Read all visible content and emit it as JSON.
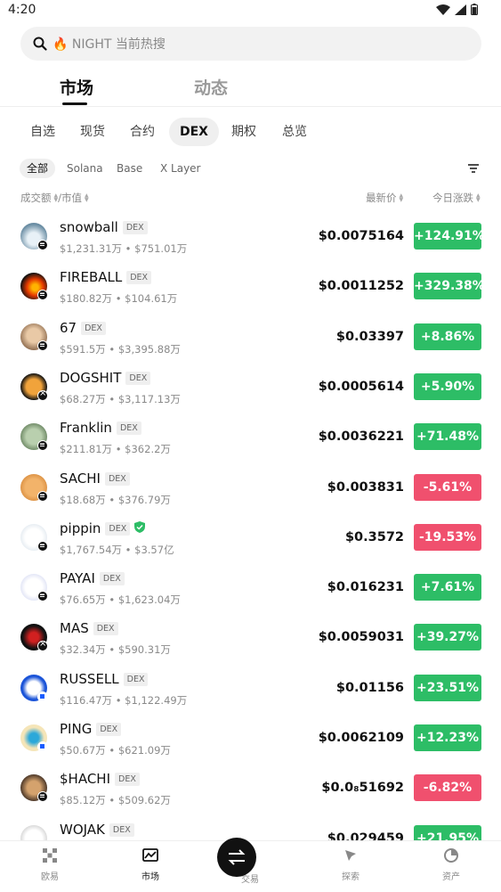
{
  "status": {
    "time": "4:20"
  },
  "search": {
    "placeholder": "🔥 NIGHT 当前热搜"
  },
  "main_tabs": [
    {
      "label": "市场"
    },
    {
      "label": "动态"
    }
  ],
  "category_tabs": [
    {
      "label": "自选"
    },
    {
      "label": "现货"
    },
    {
      "label": "合约"
    },
    {
      "label": "DEX"
    },
    {
      "label": "期权"
    },
    {
      "label": "总览"
    }
  ],
  "chain_tabs": [
    {
      "label": "全部"
    },
    {
      "label": "Solana"
    },
    {
      "label": "Base"
    },
    {
      "label": "X Layer"
    }
  ],
  "columns": {
    "volume": "成交额",
    "sep": " / ",
    "mcap": "市值",
    "price": "最新价",
    "change": "今日涨跌"
  },
  "badge": "DEX",
  "tokens": [
    {
      "name": "snowball",
      "vol": "$1,231.31万",
      "mcap": "$751.01万",
      "price": "$0.0075164",
      "change": "+124.91%",
      "dir": "up",
      "chain": "sol"
    },
    {
      "name": "FIREBALL",
      "vol": "$180.82万",
      "mcap": "$104.61万",
      "price": "$0.0011252",
      "change": "+329.38%",
      "dir": "up",
      "chain": "sol"
    },
    {
      "name": "67",
      "vol": "$591.5万",
      "mcap": "$3,395.88万",
      "price": "$0.03397",
      "change": "+8.86%",
      "dir": "up",
      "chain": "sol"
    },
    {
      "name": "DOGSHIT",
      "vol": "$68.27万",
      "mcap": "$3,117.13万",
      "price": "$0.0005614",
      "change": "+5.90%",
      "dir": "up",
      "chain": "x"
    },
    {
      "name": "Franklin",
      "vol": "$211.81万",
      "mcap": "$362.2万",
      "price": "$0.0036221",
      "change": "+71.48%",
      "dir": "up",
      "chain": "sol"
    },
    {
      "name": "SACHI",
      "vol": "$18.68万",
      "mcap": "$376.79万",
      "price": "$0.003831",
      "change": "-5.61%",
      "dir": "down",
      "chain": "sol"
    },
    {
      "name": "pippin",
      "vol": "$1,767.54万",
      "mcap": "$3.57亿",
      "price": "$0.3572",
      "change": "-19.53%",
      "dir": "down",
      "chain": "sol"
    },
    {
      "name": "PAYAI",
      "vol": "$76.65万",
      "mcap": "$1,623.04万",
      "price": "$0.016231",
      "change": "+7.61%",
      "dir": "up",
      "chain": "sol"
    },
    {
      "name": "MAS",
      "vol": "$32.34万",
      "mcap": "$590.31万",
      "price": "$0.0059031",
      "change": "+39.27%",
      "dir": "up",
      "chain": "x"
    },
    {
      "name": "RUSSELL",
      "vol": "$116.47万",
      "mcap": "$1,122.49万",
      "price": "$0.01156",
      "change": "+23.51%",
      "dir": "up",
      "chain": "blue"
    },
    {
      "name": "PING",
      "vol": "$50.67万",
      "mcap": "$621.09万",
      "price": "$0.0062109",
      "change": "+12.23%",
      "dir": "up",
      "chain": "blue"
    },
    {
      "name": "$HACHI",
      "vol": "$85.12万",
      "mcap": "$509.62万",
      "price": "$0.0₈51692",
      "change": "-6.82%",
      "dir": "down",
      "chain": "sol"
    },
    {
      "name": "WOJAK",
      "vol": "",
      "mcap": "",
      "price": "$0.029459",
      "change": "+21.95%",
      "dir": "up",
      "chain": "sol"
    }
  ],
  "bottom_nav": [
    {
      "label": "欧易"
    },
    {
      "label": "市场"
    },
    {
      "label": "交易"
    },
    {
      "label": "探索"
    },
    {
      "label": "资产"
    }
  ],
  "colors": {
    "up": "#2dbd66",
    "down": "#f0506e"
  }
}
